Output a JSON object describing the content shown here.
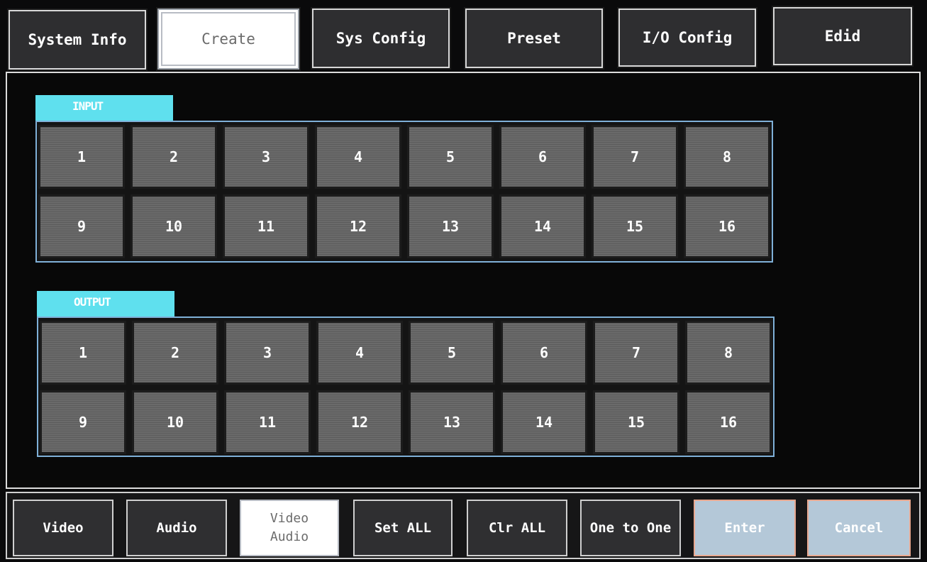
{
  "tabs": [
    {
      "label": "System Info"
    },
    {
      "label": "Create"
    },
    {
      "label": "Sys Config"
    },
    {
      "label": "Preset"
    },
    {
      "label": "I/O Config"
    },
    {
      "label": "Edid"
    }
  ],
  "input": {
    "label": "INPUT",
    "channels": [
      "1",
      "2",
      "3",
      "4",
      "5",
      "6",
      "7",
      "8",
      "9",
      "10",
      "11",
      "12",
      "13",
      "14",
      "15",
      "16"
    ]
  },
  "output": {
    "label": "OUTPUT",
    "channels": [
      "1",
      "2",
      "3",
      "4",
      "5",
      "6",
      "7",
      "8",
      "9",
      "10",
      "11",
      "12",
      "13",
      "14",
      "15",
      "16"
    ]
  },
  "bottom": {
    "video": "Video",
    "audio": "Audio",
    "video_audio_line1": "Video",
    "video_audio_line2": "Audio",
    "set_all": "Set ALL",
    "clr_all": "Clr ALL",
    "one_to_one": "One to One",
    "enter": "Enter",
    "cancel": "Cancel"
  },
  "colors": {
    "group_tab": "#5fe0ee",
    "grid_border": "#7fb0d8",
    "cell": "#666666",
    "disabled_button": "#b4c8d8"
  }
}
